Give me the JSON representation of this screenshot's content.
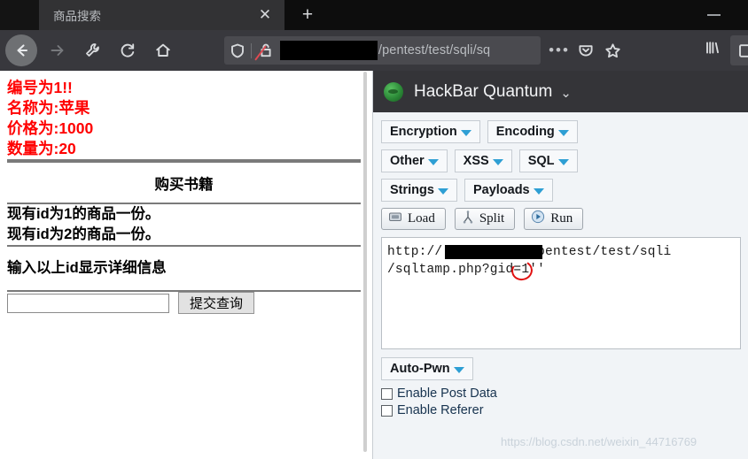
{
  "browser": {
    "tab": {
      "title": "商品搜索",
      "close_label": "✕"
    },
    "new_tab_label": "+",
    "window": {
      "minimize_label": "—"
    },
    "nav": {
      "back": "back-arrow",
      "forward": "forward-arrow",
      "tools": "wrench-icon",
      "reload": "reload-icon",
      "home": "home-icon"
    },
    "urlbar": {
      "shield_icon": "shield-icon",
      "lock_icon": "lock-broken-icon",
      "redacted": "",
      "url_text": "/pentest/test/sqli/sq",
      "more_icon": "ellipsis-icon",
      "pocket_icon": "pocket-icon",
      "bookmark_icon": "star-icon",
      "library_icon": "library-icon"
    }
  },
  "page": {
    "info_lines": [
      "编号为1!!",
      "名称为:苹果",
      "价格为:1000",
      "数量为:20"
    ],
    "section_title": "购买书籍",
    "stock_lines": [
      "现有id为1的商品一份。",
      "现有id为2的商品一份。"
    ],
    "prompt": "输入以上id显示详细信息",
    "form": {
      "input_value": "",
      "input_placeholder": "",
      "submit_label": "提交查询"
    }
  },
  "hackbar": {
    "title": "HackBar Quantum",
    "menu_caret": "⌄",
    "logo_icon": "hackbar-logo-icon",
    "rows": [
      [
        {
          "label": "Encryption",
          "name": "encryption-button"
        },
        {
          "label": "Encoding",
          "name": "encoding-button"
        }
      ],
      [
        {
          "label": "Other",
          "name": "other-button"
        },
        {
          "label": "XSS",
          "name": "xss-button"
        },
        {
          "label": "SQL",
          "name": "sql-button"
        }
      ],
      [
        {
          "label": "Strings",
          "name": "strings-button"
        },
        {
          "label": "Payloads",
          "name": "payloads-button"
        }
      ]
    ],
    "actions": [
      {
        "label": "Load",
        "icon": "load-icon"
      },
      {
        "label": "Split",
        "icon": "split-icon"
      },
      {
        "label": "Run",
        "icon": "run-icon"
      }
    ],
    "url_area": {
      "line1_prefix": "http://",
      "line1_suffix": "/pentest/test/sqli",
      "line2": "/sqltamp.php?gid=1''",
      "annotation": "red-circle-annotation"
    },
    "autopwn_label": "Auto-Pwn",
    "checkboxes": [
      {
        "label": "Enable Post Data",
        "checked": false
      },
      {
        "label": "Enable Referer",
        "checked": false
      }
    ]
  },
  "watermark": {
    "text": "https://blog.csdn.net/weixin_44716769"
  },
  "colors": {
    "accent_blue": "#2e9fd4",
    "alert_red": "#ff0000",
    "annotation_red": "#e11010",
    "panel_bg": "#f1f4f7",
    "chrome_dark": "#38383d"
  }
}
